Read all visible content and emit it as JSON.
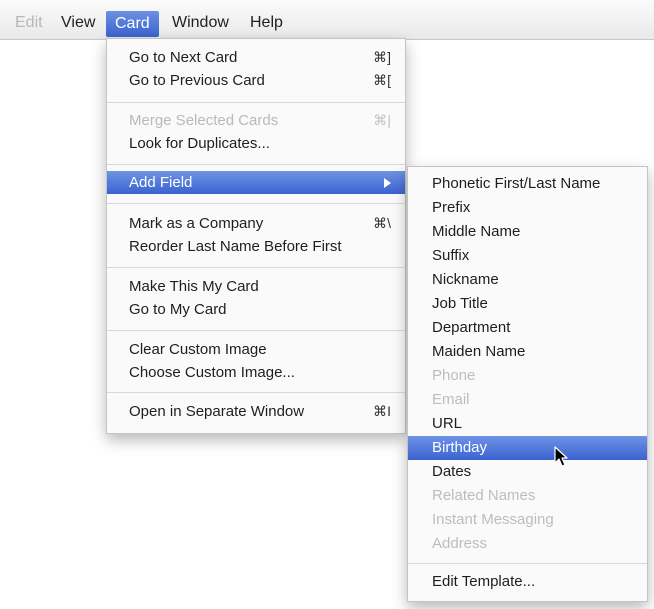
{
  "menubar": {
    "items": [
      {
        "label": "Edit",
        "state": "faded"
      },
      {
        "label": "View",
        "state": "normal"
      },
      {
        "label": "Card",
        "state": "active"
      },
      {
        "label": "Window",
        "state": "normal"
      },
      {
        "label": "Help",
        "state": "normal"
      }
    ]
  },
  "card_menu": {
    "items": [
      {
        "label": "Go to Next Card",
        "shortcut": "⌘]",
        "state": "normal"
      },
      {
        "label": "Go to Previous Card",
        "shortcut": "⌘[",
        "state": "normal"
      },
      {
        "label": "Merge Selected Cards",
        "shortcut": "⌘|",
        "state": "disabled"
      },
      {
        "label": "Look for Duplicates...",
        "shortcut": "",
        "state": "normal"
      },
      {
        "label": "Add Field",
        "shortcut": "",
        "state": "highlighted",
        "has_submenu": true
      },
      {
        "label": "Mark as a Company",
        "shortcut": "⌘\\",
        "state": "normal"
      },
      {
        "label": "Reorder Last Name Before First",
        "shortcut": "",
        "state": "normal"
      },
      {
        "label": "Make This My Card",
        "shortcut": "",
        "state": "normal"
      },
      {
        "label": "Go to My Card",
        "shortcut": "",
        "state": "normal"
      },
      {
        "label": "Clear Custom Image",
        "shortcut": "",
        "state": "normal"
      },
      {
        "label": "Choose Custom Image...",
        "shortcut": "",
        "state": "normal"
      },
      {
        "label": "Open in Separate Window",
        "shortcut": "⌘I",
        "state": "normal"
      }
    ]
  },
  "add_field_submenu": {
    "items": [
      {
        "label": "Phonetic First/Last Name",
        "state": "normal"
      },
      {
        "label": "Prefix",
        "state": "normal"
      },
      {
        "label": "Middle Name",
        "state": "normal"
      },
      {
        "label": "Suffix",
        "state": "normal"
      },
      {
        "label": "Nickname",
        "state": "normal"
      },
      {
        "label": "Job Title",
        "state": "normal"
      },
      {
        "label": "Department",
        "state": "normal"
      },
      {
        "label": "Maiden Name",
        "state": "normal"
      },
      {
        "label": "Phone",
        "state": "disabled"
      },
      {
        "label": "Email",
        "state": "disabled"
      },
      {
        "label": "URL",
        "state": "normal"
      },
      {
        "label": "Birthday",
        "state": "highlighted"
      },
      {
        "label": "Dates",
        "state": "normal"
      },
      {
        "label": "Related Names",
        "state": "disabled"
      },
      {
        "label": "Instant Messaging",
        "state": "disabled"
      },
      {
        "label": "Address",
        "state": "disabled"
      },
      {
        "label": "Edit Template...",
        "state": "normal"
      }
    ]
  },
  "colors": {
    "highlight": "#3a63cf",
    "disabled_text": "#b9b9b9"
  }
}
